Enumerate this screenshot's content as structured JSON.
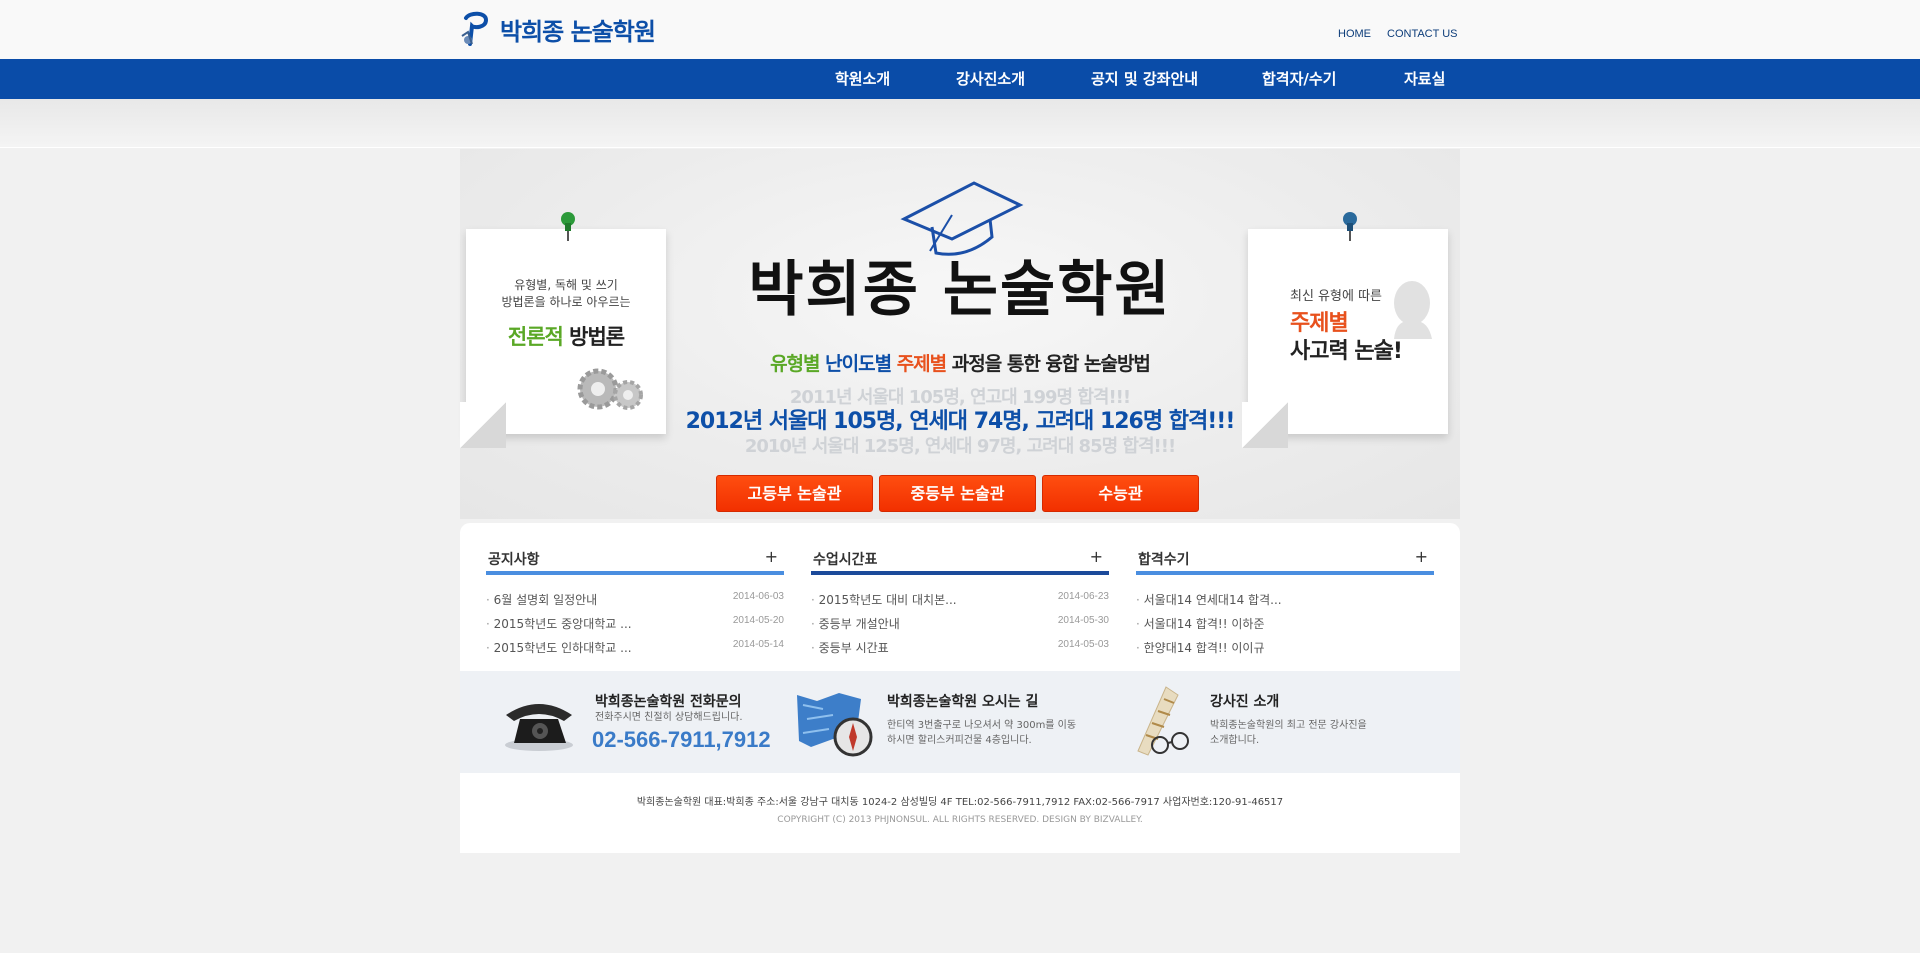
{
  "header": {
    "logo_text": "박희종 논술학원",
    "util": [
      "HOME",
      "CONTACT US"
    ]
  },
  "gnb": [
    "학원소개",
    "강사진소개",
    "공지 및 강좌안내",
    "합격자/수기",
    "자료실"
  ],
  "visual": {
    "left_note": {
      "line1": "유형별, 독해 및 쓰기",
      "line2": "방법론을 하나로 아우르는",
      "em_green": "전론적",
      "em_rest": " 방법론"
    },
    "right_note": {
      "line1": "최신 유형에 따른",
      "line2": "주제별",
      "line3": "사고력 논술!"
    },
    "title": "박희종 논술학원",
    "tagline": {
      "p1": "유형별",
      "p2": "난이도별",
      "p3": "주제별",
      "p4": "과정을 통한 융합 논술방법"
    },
    "ghost_top": "2011년 서울대 105명, 연고대 199명 합격!!!",
    "highlight": "2012년 서울대 105명, 연세대 74명, 고려대 126명 합격!!!",
    "ghost_bottom": "2010년 서울대 125명, 연세대 97명, 고려대 85명 합격!!!",
    "buttons": [
      "고등부 논술관",
      "중등부 논술관",
      "수능관"
    ]
  },
  "boards": [
    {
      "title": "공지사항",
      "more": "+",
      "items": [
        {
          "text": "6월 설명회 일정안내",
          "date": "2014-06-03"
        },
        {
          "text": "2015학년도 중앙대학교 ...",
          "date": "2014-05-20"
        },
        {
          "text": "2015학년도 인하대학교 ...",
          "date": "2014-05-14"
        }
      ]
    },
    {
      "title": "수업시간표",
      "more": "+",
      "items": [
        {
          "text": "2015학년도 대비 대치본...",
          "date": "2014-06-23"
        },
        {
          "text": "중등부 개설안내",
          "date": "2014-05-30"
        },
        {
          "text": "중등부 시간표",
          "date": "2014-05-03"
        }
      ]
    },
    {
      "title": "합격수기",
      "more": "+",
      "items": [
        {
          "text": "서울대14 연세대14 합격...",
          "date": ""
        },
        {
          "text": "서울대14 합격!! 이하준",
          "date": ""
        },
        {
          "text": "한양대14 합격!! 이이규",
          "date": ""
        }
      ]
    }
  ],
  "info": {
    "phone_block": {
      "title": "박희종논술학원 전화문의",
      "desc": "전화주시면 친절히 상담해드립니다.",
      "phone": "02-566-7911,7912"
    },
    "map_block": {
      "title": "박희종논술학원 오시는 길",
      "desc1": "한티역 3번출구로 나오셔서 약 300m를 이동",
      "desc2": "하시면 할리스커피건물 4층입니다."
    },
    "staff_block": {
      "title": "강사진 소개",
      "desc1": "박희종논술학원의 최고 전문 강사진을",
      "desc2": "소개합니다."
    }
  },
  "footer": {
    "line1": "박희종논술학원 대표:박희종 주소:서울 강남구 대치동 1024-2 삼성빌딩 4F TEL:02-566-7911,7912 FAX:02-566-7917 사업자번호:120-91-46517",
    "line2": "COPYRIGHT (C) 2013 PHJNONSUL. ALL RIGHTS RESERVED. DESIGN BY BIZVALLEY."
  }
}
